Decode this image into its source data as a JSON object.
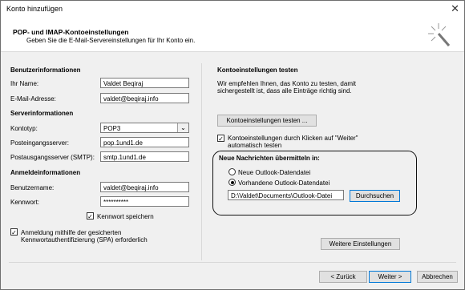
{
  "window": {
    "title": "Konto hinzufügen",
    "close_label": "✕"
  },
  "header": {
    "title": "POP- und IMAP-Kontoeinstellungen",
    "subtitle": "Geben Sie die E-Mail-Servereinstellungen für Ihr Konto ein."
  },
  "left": {
    "user_section": "Benutzerinformationen",
    "name_label": "Ihr Name:",
    "name_value": "Valdet Beqiraj",
    "email_label": "E-Mail-Adresse:",
    "email_value": "valdet@beqiraj.info",
    "server_section": "Serverinformationen",
    "account_type_label": "Kontotyp:",
    "account_type_value": "POP3",
    "incoming_label": "Posteingangsserver:",
    "incoming_value": "pop.1und1.de",
    "outgoing_label": "Postausgangsserver (SMTP):",
    "outgoing_value": "smtp.1und1.de",
    "login_section": "Anmeldeinformationen",
    "username_label": "Benutzername:",
    "username_value": "valdet@beqiraj.info",
    "password_label": "Kennwort:",
    "password_value": "**********",
    "save_password_label": "Kennwort speichern",
    "spa_label_1": "Anmeldung mithilfe der gesicherten",
    "spa_label_2": "Kennwortauthentifizierung (SPA) erforderlich"
  },
  "right": {
    "test_section": "Kontoeinstellungen testen",
    "test_desc_1": "Wir empfehlen Ihnen, das Konto zu testen, damit",
    "test_desc_2": "sichergestellt ist, dass alle Einträge richtig sind.",
    "test_button": "Kontoeinstellungen testen ...",
    "auto_test_1": "Kontoeinstellungen durch Klicken auf \"Weiter\"",
    "auto_test_2": "automatisch testen",
    "deliver_section": "Neue Nachrichten übermitteln in:",
    "new_file_label": "Neue Outlook-Datendatei",
    "existing_file_label": "Vorhandene Outlook-Datendatei",
    "path_value": "D:\\Valdet\\Documents\\Outlook-Datei",
    "browse_button": "Durchsuchen",
    "more_settings_button": "Weitere Einstellungen"
  },
  "footer": {
    "back_button": "< Zurück",
    "next_button": "Weiter >",
    "cancel_button": "Abbrechen"
  }
}
